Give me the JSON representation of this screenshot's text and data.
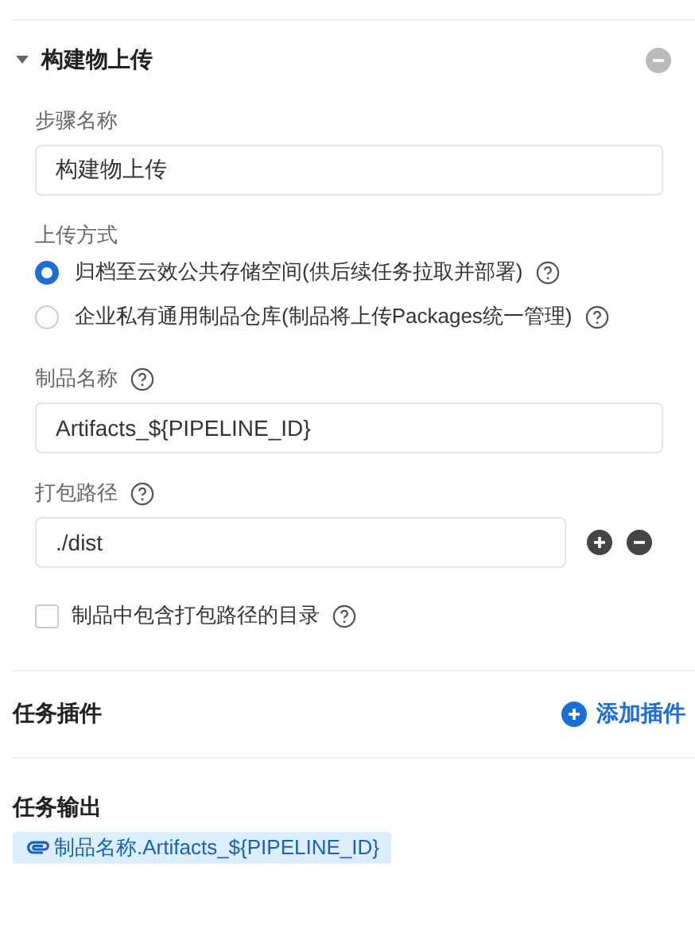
{
  "step": {
    "title": "构建物上传",
    "expanded": true,
    "fields": [
      {
        "kind": "text",
        "label": "步骤名称",
        "help": false,
        "value": "构建物上传"
      },
      {
        "kind": "radio",
        "label": "上传方式",
        "options": [
          {
            "label": "归档至云效公共存储空间(供后续任务拉取并部署)",
            "selected": true
          },
          {
            "label": "企业私有通用制品仓库(制品将上传Packages统一管理)",
            "selected": false
          }
        ]
      },
      {
        "kind": "text",
        "label": "制品名称",
        "help": true,
        "value": "Artifacts_${PIPELINE_ID}"
      },
      {
        "kind": "path",
        "label": "打包路径",
        "help": true,
        "value": "./dist"
      },
      {
        "kind": "checkbox",
        "label": "制品中包含打包路径的目录",
        "checked": false
      }
    ]
  },
  "plugins": {
    "title": "任务插件",
    "add": "添加插件"
  },
  "outputs": {
    "title": "任务输出",
    "items": [
      "制品名称.Artifacts_${PIPELINE_ID}"
    ]
  }
}
